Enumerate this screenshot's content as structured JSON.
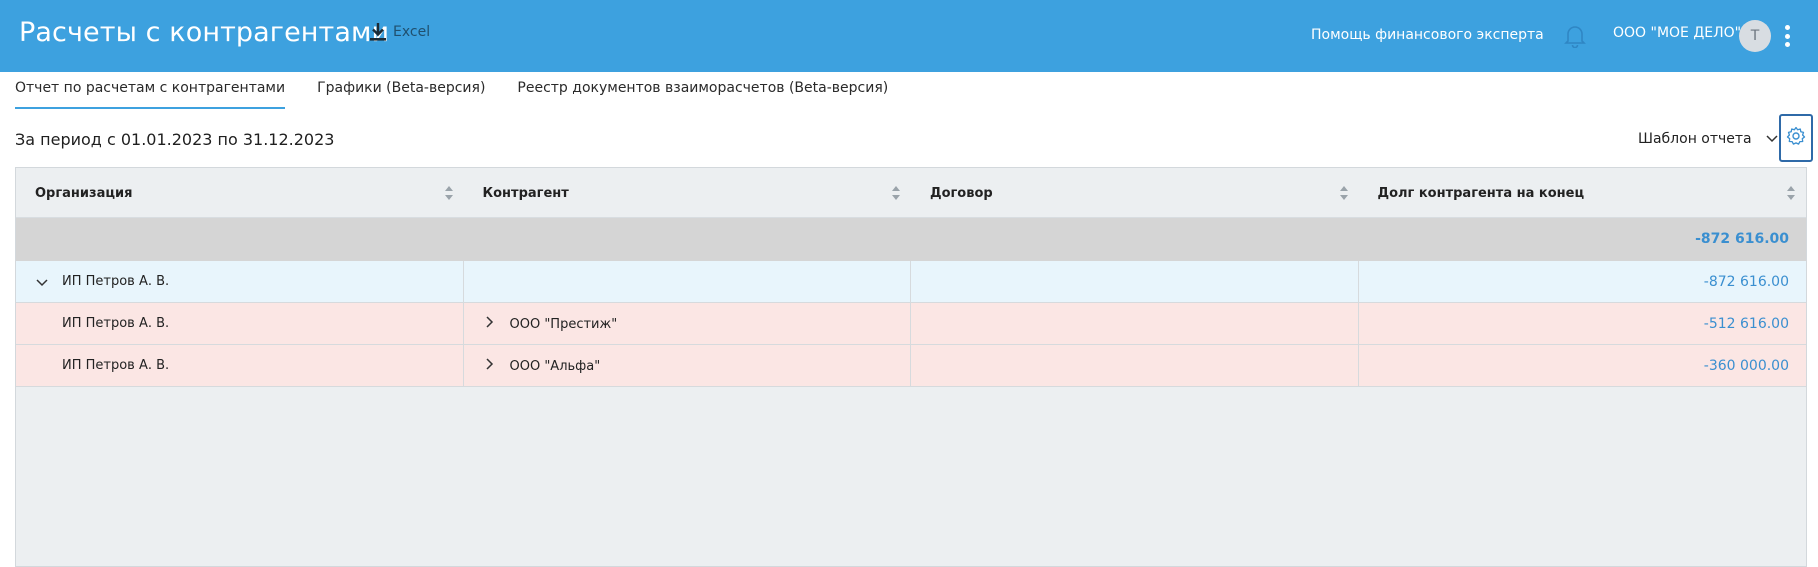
{
  "header": {
    "title": "Расчеты с контрагентами",
    "excel_label": "Excel",
    "help_link": "Помощь финансового эксперта",
    "org_name": "ООО \"МОЕ ДЕЛО\"",
    "avatar_letter": "Т",
    "bg_color": "#3da1df"
  },
  "tabs": [
    {
      "label": "Отчет по расчетам с контрагентами",
      "active": true
    },
    {
      "label": "Графики (Beta-версия)",
      "active": false
    },
    {
      "label": "Реестр документов взаиморасчетов (Beta-версия)",
      "active": false
    }
  ],
  "toolbar": {
    "period": "За период с 01.01.2023 по 31.12.2023",
    "template_label": "Шаблон отчета"
  },
  "table": {
    "columns": [
      "Организация",
      "Контрагент",
      "Договор",
      "Долг контрагента на конец"
    ],
    "total": "-872 616.00",
    "group": {
      "organization": "ИП Петров А. В.",
      "amount": "-872 616.00"
    },
    "rows": [
      {
        "organization": "ИП Петров А. В.",
        "counterparty": "ООО \"Престиж\"",
        "contract": "",
        "amount": "-512 616.00"
      },
      {
        "organization": "ИП Петров А. В.",
        "counterparty": "ООО \"Альфа\"",
        "contract": "",
        "amount": "-360 000.00"
      }
    ]
  },
  "colors": {
    "accent": "#3da1df",
    "amount": "#3a8fd0",
    "group_row": "#e8f5fc",
    "child_row": "#fbe6e4",
    "total_row": "#d5d5d5"
  }
}
